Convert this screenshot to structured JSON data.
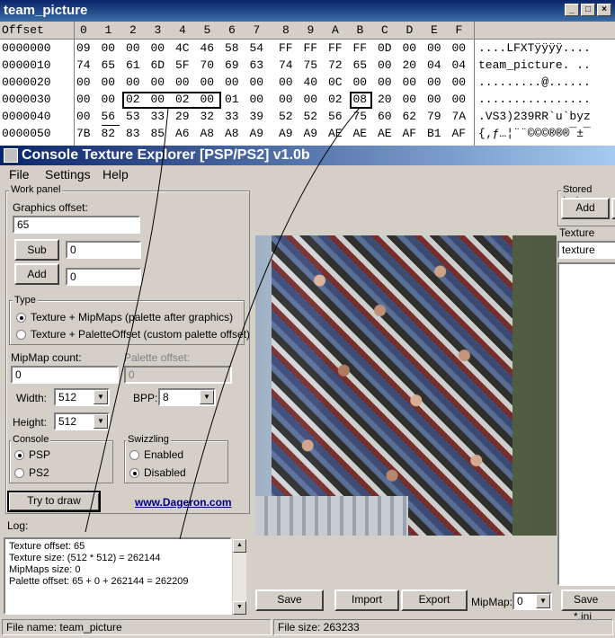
{
  "hex": {
    "title": "team_picture",
    "header": [
      "Offset",
      "0",
      "1",
      "2",
      "3",
      "4",
      "5",
      "6",
      "7",
      "8",
      "9",
      "A",
      "B",
      "C",
      "D",
      "E",
      "F"
    ],
    "rows": [
      {
        "offset": "0000000",
        "bytes": [
          "09",
          "00",
          "00",
          "00",
          "4C",
          "46",
          "58",
          "54",
          "FF",
          "FF",
          "FF",
          "FF",
          "0D",
          "00",
          "00",
          "00"
        ],
        "ascii": "....LFXTÿÿÿÿ...."
      },
      {
        "offset": "0000010",
        "bytes": [
          "74",
          "65",
          "61",
          "6D",
          "5F",
          "70",
          "69",
          "63",
          "74",
          "75",
          "72",
          "65",
          "00",
          "20",
          "04",
          "04"
        ],
        "ascii": "team_picture. .."
      },
      {
        "offset": "0000020",
        "bytes": [
          "00",
          "00",
          "00",
          "00",
          "00",
          "00",
          "00",
          "00",
          "00",
          "40",
          "0C",
          "00",
          "00",
          "00",
          "00",
          "00"
        ],
        "ascii": ".........@......"
      },
      {
        "offset": "0000030",
        "bytes": [
          "00",
          "00",
          "02",
          "00",
          "02",
          "00",
          "01",
          "00",
          "00",
          "00",
          "02",
          "08",
          "20",
          "00",
          "00",
          "00"
        ],
        "ascii": "................"
      },
      {
        "offset": "0000040",
        "bytes": [
          "00",
          "56",
          "53",
          "33",
          "29",
          "32",
          "33",
          "39",
          "52",
          "52",
          "56",
          "75",
          "60",
          "62",
          "79",
          "7A"
        ],
        "ascii": ".VS3)239RR`u`byz"
      },
      {
        "offset": "0000050",
        "bytes": [
          "7B",
          "82",
          "83",
          "85",
          "A6",
          "A8",
          "A8",
          "A9",
          "A9",
          "A9",
          "AE",
          "AE",
          "AE",
          "AF",
          "B1",
          "AF"
        ],
        "ascii": "{‚ƒ…¦¨¨©©©®®®¯±¯"
      }
    ]
  },
  "app": {
    "title": "Console Texture Explorer [PSP/PS2] v1.0b",
    "menu": [
      "File",
      "Settings",
      "Help"
    ],
    "work_panel_label": "Work panel",
    "graphics_offset_label": "Graphics offset:",
    "graphics_offset_value": "65",
    "sub_label": "Sub",
    "sub_value": "0",
    "add_label": "Add",
    "add_value": "0",
    "type_label": "Type",
    "type_options": [
      "Texture + MipMaps (palette after graphics)",
      "Texture + PaletteOffset (custom palette offset)"
    ],
    "mipmap_count_label": "MipMap count:",
    "mipmap_count_value": "0",
    "palette_offset_label": "Palette offset:",
    "palette_offset_value": "0",
    "width_label": "Width:",
    "width_value": "512",
    "bpp_label": "BPP:",
    "bpp_value": "8",
    "height_label": "Height:",
    "height_value": "512",
    "console_label": "Console",
    "console_options": [
      "PSP",
      "PS2"
    ],
    "swizzling_label": "Swizzling",
    "swizzling_options": [
      "Enabled",
      "Disabled"
    ],
    "try_draw_label": "Try to draw",
    "link_text": "www.Dageron.com",
    "log_label": "Log:",
    "log_lines": [
      "Texture offset: 65",
      "Texture size: (512 * 512) = 262144",
      "MipMaps size: 0",
      "Palette offset: 65 + 0 + 262144 = 262209"
    ],
    "stored_label": "Stored textu",
    "stored_add_label": "Add",
    "texture_name_label": "Texture nam",
    "texture_name_value": "texture",
    "save_label": "Save",
    "import_label": "Import",
    "export_label": "Export",
    "mipmap_label": "MipMap:",
    "mipmap_value": "0",
    "save_ini_label": "Save *.ini",
    "status_filename": "File name: team_picture",
    "status_filesize": "File size: 263233"
  }
}
